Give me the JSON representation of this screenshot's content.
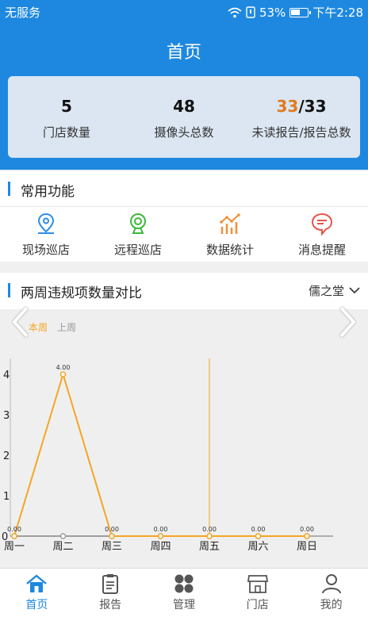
{
  "status": {
    "carrier": "无服务",
    "battery": "53%",
    "time": "下午2:28"
  },
  "header": {
    "title": "首页"
  },
  "stats": [
    {
      "value": "5",
      "label": "门店数量"
    },
    {
      "value": "48",
      "label": "摄像头总数"
    },
    {
      "value_unread": "33",
      "value_total": "/33",
      "label": "未读报告/报告总数"
    }
  ],
  "common": {
    "title": "常用功能",
    "items": [
      {
        "label": "现场巡店",
        "icon": "location-pin-icon"
      },
      {
        "label": "远程巡店",
        "icon": "webcam-icon"
      },
      {
        "label": "数据统计",
        "icon": "bar-chart-icon"
      },
      {
        "label": "消息提醒",
        "icon": "message-icon"
      }
    ]
  },
  "comparison": {
    "title": "两周违规项数量对比",
    "store": "儒之堂",
    "legend": [
      "本周",
      "上周"
    ]
  },
  "chart_data": {
    "type": "line",
    "categories": [
      "周一",
      "周二",
      "周三",
      "周四",
      "周五",
      "周六",
      "周日"
    ],
    "series": [
      {
        "name": "本周",
        "values": [
          0,
          4,
          0,
          0,
          0,
          0,
          0
        ],
        "labels": [
          "0.00",
          "4.00",
          "0.00",
          "0.00",
          "0.00",
          "0.00",
          "0.00"
        ],
        "color": "#f5a623"
      },
      {
        "name": "上周",
        "values": [
          0,
          0,
          0,
          0,
          0,
          0,
          0
        ],
        "color": "#9e9e9e"
      }
    ],
    "yticks": [
      "0",
      "1",
      "2",
      "3",
      "4"
    ],
    "ylim": [
      0,
      4
    ],
    "highlight_category": "周五"
  },
  "bottom_nav": [
    {
      "label": "首页",
      "icon": "home-icon",
      "active": true
    },
    {
      "label": "报告",
      "icon": "clipboard-icon",
      "active": false
    },
    {
      "label": "管理",
      "icon": "grid-icon",
      "active": false
    },
    {
      "label": "门店",
      "icon": "store-icon",
      "active": false
    },
    {
      "label": "我的",
      "icon": "user-icon",
      "active": false
    }
  ],
  "colors": {
    "primary": "#1e88e0",
    "accent": "#e07a1c",
    "line": "#f5a623"
  }
}
